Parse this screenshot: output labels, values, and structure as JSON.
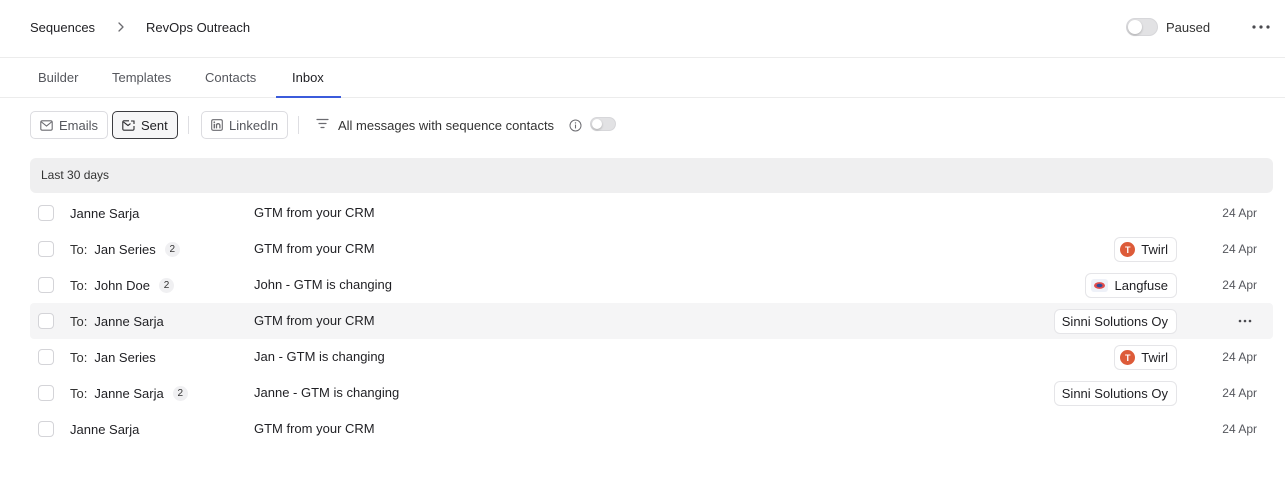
{
  "breadcrumb": {
    "root": "Sequences",
    "current": "RevOps Outreach"
  },
  "status": {
    "toggle_on": false,
    "label": "Paused"
  },
  "tabs": [
    {
      "label": "Builder",
      "active": false
    },
    {
      "label": "Templates",
      "active": false
    },
    {
      "label": "Contacts",
      "active": false
    },
    {
      "label": "Inbox",
      "active": true
    }
  ],
  "filters": {
    "emails_label": "Emails",
    "sent_label": "Sent",
    "linkedin_label": "LinkedIn",
    "sequence_filter_label": "All messages with sequence contacts",
    "sequence_filter_on": false
  },
  "group": {
    "label": "Last 30 days"
  },
  "rows": [
    {
      "prefix": "",
      "name": "Janne Sarja",
      "count": "",
      "subject": "GTM from your CRM",
      "company": "",
      "logo": "",
      "date": "24 Apr"
    },
    {
      "prefix": "To:",
      "name": "Jan Series",
      "count": "2",
      "subject": "GTM from your CRM",
      "company": "Twirl",
      "logo": "twirl",
      "date": "24 Apr"
    },
    {
      "prefix": "To:",
      "name": "John Doe",
      "count": "2",
      "subject": "John - GTM is changing",
      "company": "Langfuse",
      "logo": "langfuse",
      "date": "24 Apr"
    },
    {
      "prefix": "To:",
      "name": "Janne Sarja",
      "count": "",
      "subject": "GTM from your CRM",
      "company": "Sinni Solutions Oy",
      "logo": "",
      "date": "",
      "hover": true
    },
    {
      "prefix": "To:",
      "name": "Jan Series",
      "count": "",
      "subject": "Jan - GTM is changing",
      "company": "Twirl",
      "logo": "twirl",
      "date": "24 Apr"
    },
    {
      "prefix": "To:",
      "name": "Janne Sarja",
      "count": "2",
      "subject": "Janne - GTM is changing",
      "company": "Sinni Solutions Oy",
      "logo": "",
      "date": "24 Apr"
    },
    {
      "prefix": "",
      "name": "Janne Sarja",
      "count": "",
      "subject": "GTM from your CRM",
      "company": "",
      "logo": "",
      "date": "24 Apr"
    }
  ],
  "colors": {
    "accent": "#3b5bdb",
    "twirl_logo": "#dd5b39"
  }
}
